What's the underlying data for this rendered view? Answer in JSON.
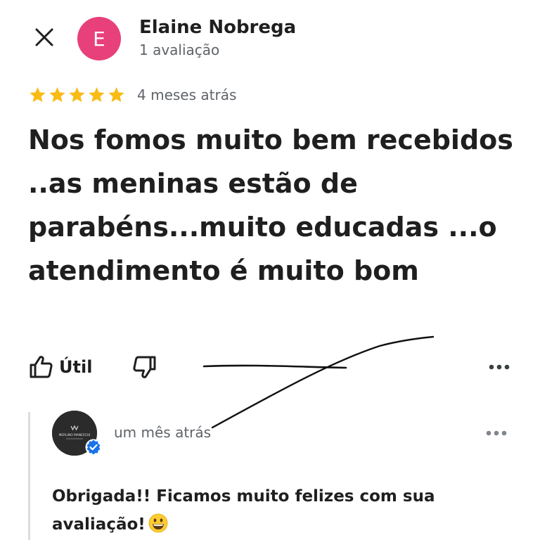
{
  "header": {
    "close_icon": "close-icon",
    "avatar_letter": "E",
    "avatar_color": "#e8407a",
    "reviewer_name": "Elaine Nobrega",
    "review_count": "1 avaliação"
  },
  "review": {
    "rating": 5,
    "max_rating": 5,
    "star_color": "#f9bb14",
    "date": "4 meses atrás",
    "text": "Nos fomos muito bem recebidos ..as meninas estão de parabéns...muito educadas ...o atendimento é muito bom"
  },
  "actions": {
    "useful_label": "Útil",
    "useful_icon": "thumbs-up-icon",
    "not_useful_icon": "thumbs-down-icon",
    "more_icon": "more-options-icon"
  },
  "owner_reply": {
    "logo_text": "MERLINO MANESCHI",
    "verified_color": "#1a73e8",
    "date": "um mês atrás",
    "text": "Obrigada!! Ficamos muito felizes com sua avaliação!",
    "emoji": "grinning-face-icon",
    "more_icon": "more-options-icon"
  }
}
